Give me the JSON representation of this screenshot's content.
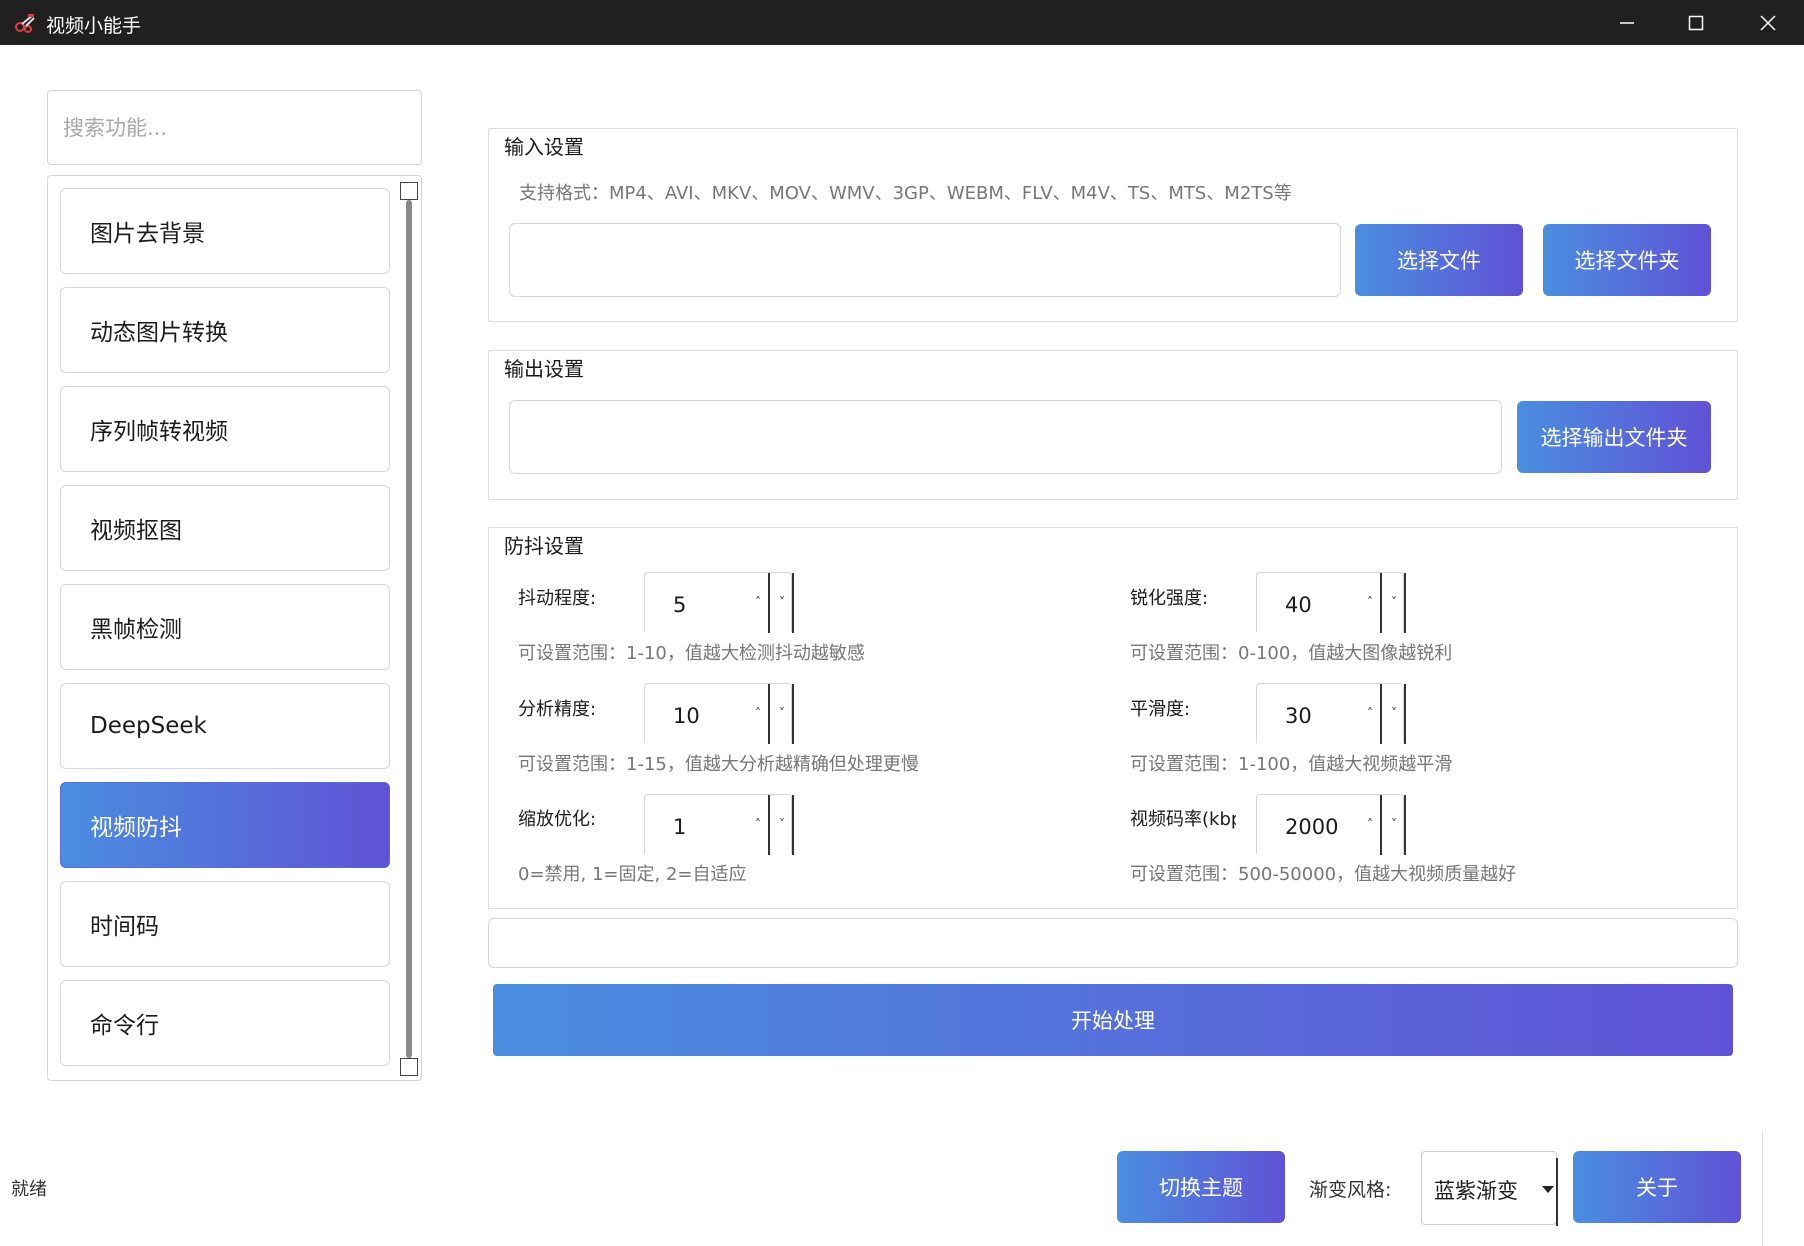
{
  "window": {
    "title": "视频小能手"
  },
  "sidebar": {
    "search_placeholder": "搜索功能...",
    "items": [
      {
        "label": "图片去背景",
        "active": false
      },
      {
        "label": "动态图片转换",
        "active": false
      },
      {
        "label": "序列帧转视频",
        "active": false
      },
      {
        "label": "视频抠图",
        "active": false
      },
      {
        "label": "黑帧检测",
        "active": false
      },
      {
        "label": "DeepSeek",
        "active": false
      },
      {
        "label": "视频防抖",
        "active": true
      },
      {
        "label": "时间码",
        "active": false
      },
      {
        "label": "命令行",
        "active": false
      }
    ]
  },
  "input_settings": {
    "title": "输入设置",
    "formats": "支持格式：MP4、AVI、MKV、MOV、WMV、3GP、WEBM、FLV、M4V、TS、MTS、M2TS等",
    "path_value": "",
    "select_file_label": "选择文件",
    "select_folder_label": "选择文件夹"
  },
  "output_settings": {
    "title": "输出设置",
    "path_value": "",
    "select_output_label": "选择输出文件夹"
  },
  "stabilize_settings": {
    "title": "防抖设置",
    "params": [
      {
        "label": "抖动程度:",
        "value": "5",
        "hint": "可设置范围：1-10，值越大检测抖动越敏感"
      },
      {
        "label": "锐化强度:",
        "value": "40",
        "hint": "可设置范围：0-100，值越大图像越锐利"
      },
      {
        "label": "分析精度:",
        "value": "10",
        "hint": "可设置范围：1-15，值越大分析越精确但处理更慢"
      },
      {
        "label": "平滑度:",
        "value": "30",
        "hint": "可设置范围：1-100，值越大视频越平滑"
      },
      {
        "label": "缩放优化:",
        "value": "1",
        "hint": "0=禁用, 1=固定, 2=自适应"
      },
      {
        "label": "视频码率(kbps)",
        "value": "2000",
        "hint": "可设置范围：500-50000，值越大视频质量越好"
      }
    ],
    "spin_up_glyph": "˄",
    "spin_down_glyph": "˅"
  },
  "start_button_label": "开始处理",
  "bottom_bar": {
    "status": "就绪",
    "switch_theme_label": "切换主题",
    "gradient_style_label": "渐变风格:",
    "gradient_style_value": "蓝紫渐变",
    "about_label": "关于"
  },
  "colors": {
    "gradient_start": "#4a8ee0",
    "gradient_end": "#6052d6",
    "titlebar_bg": "#202020"
  }
}
